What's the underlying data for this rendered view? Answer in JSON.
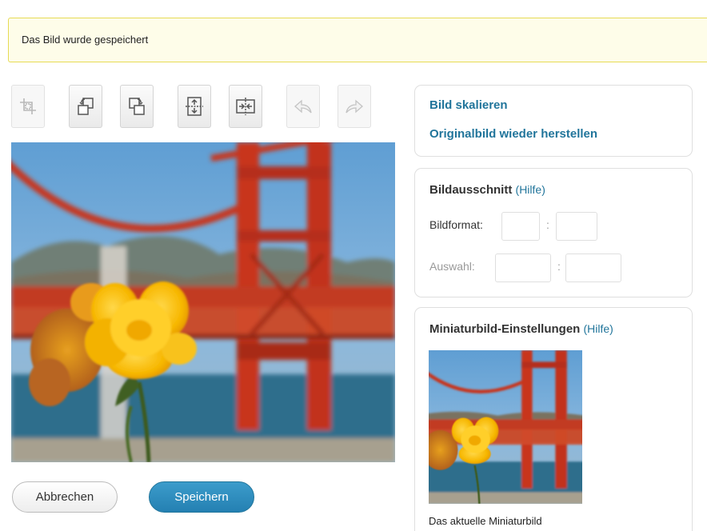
{
  "notice": {
    "text": "Das Bild wurde gespeichert"
  },
  "toolbar": {
    "tools": [
      {
        "name": "crop",
        "icon": "crop-icon",
        "enabled": false
      },
      {
        "name": "rotate-left",
        "icon": "rotate-left-icon",
        "enabled": true
      },
      {
        "name": "rotate-right",
        "icon": "rotate-right-icon",
        "enabled": true
      },
      {
        "name": "flip-vertical",
        "icon": "flip-vertical-icon",
        "enabled": true
      },
      {
        "name": "flip-horizontal",
        "icon": "flip-horizontal-icon",
        "enabled": true
      },
      {
        "name": "undo",
        "icon": "undo-icon",
        "enabled": false
      },
      {
        "name": "redo",
        "icon": "redo-icon",
        "enabled": false
      }
    ]
  },
  "actions": {
    "cancel_label": "Abbrechen",
    "save_label": "Speichern"
  },
  "scale_panel": {
    "scale_link": "Bild skalieren",
    "restore_link": "Originalbild wieder herstellen"
  },
  "crop_panel": {
    "title": "Bildausschnitt",
    "help": "(Hilfe)",
    "aspect_label": "Bildformat:",
    "aspect_w": "",
    "aspect_h": "",
    "selection_label": "Auswahl:",
    "selection_w": "",
    "selection_h": "",
    "separator": ":"
  },
  "thumbnail_panel": {
    "title": "Miniaturbild-Einstellungen",
    "help": "(Hilfe)",
    "caption": "Das aktuelle Miniaturbild"
  },
  "colors": {
    "accent": "#21759b",
    "notice_bg": "#fefde9",
    "notice_border": "#e6db55",
    "bridge": "#c8361e",
    "flower": "#f5b800"
  }
}
